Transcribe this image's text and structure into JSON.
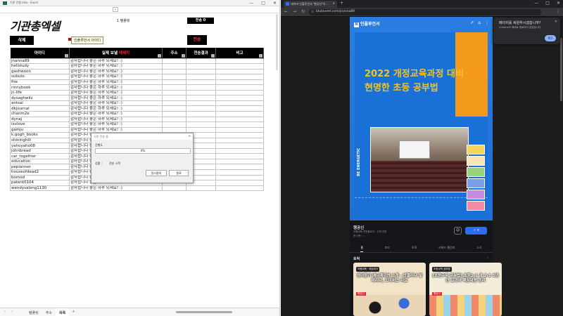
{
  "excel": {
    "title": "기관 인형.xlsx - Excel",
    "window_buttons": [
      "—",
      "□",
      "✕"
    ],
    "expand_glyph": "⌄",
    "logo": "기관총엑셀",
    "template_label": "템플릿",
    "sent_label": "전송 0",
    "delete_button": "삭제",
    "send_button": "전송",
    "comment": "인플루언서 아이디",
    "columns": [
      {
        "label": "아이디",
        "width": 84
      },
      {
        "label": "실제 보낼",
        "label_red": "메세지",
        "width": 132
      },
      {
        "label": "주소",
        "width": 34
      },
      {
        "label": "전송결과",
        "width": 42
      },
      {
        "label": "비고",
        "width": 68
      }
    ],
    "rows": [
      [
        "jnanna89",
        "감사합니다 좋은 하루 되세요! :)"
      ],
      [
        "hellstudy",
        "감사합니다 좋은 하루 되세요! :)"
      ],
      [
        "gashwoon",
        "감사합니다 좋은 하루 되세요! :)"
      ],
      [
        "subuto",
        "감사합니다 좋은 하루 되세요! :)"
      ],
      [
        "fire",
        "감사합니다 좋은 하루 되세요! :)"
      ],
      [
        "rinnybook",
        "감사합니다 좋은 하루 되세요! :)"
      ],
      [
        "jc-life",
        "감사합니다 좋은 하루 되세요! :)"
      ],
      [
        "dysaghwils",
        "감사합니다 좋은 하루 되세요! :)"
      ],
      [
        "antsal",
        "감사합니다 좋은 하루 되세요! :)"
      ],
      [
        "dkjournal",
        "감사합니다 좋은 하루 되세요! :)"
      ],
      [
        "chanm2e",
        "감사합니다 좋은 하루 되세요! :)"
      ],
      [
        "dynaj",
        "감사합니다 좋은 하루 되세요! :)"
      ],
      [
        "ixvlove",
        "감사합니다 좋은 하루 되세요! :)"
      ],
      [
        "gamju",
        "감사합니다 좋은 하루 되세요! :)"
      ],
      [
        "k.gogh_books",
        "감사합니다 좋은 하루 되세요! :)"
      ],
      [
        "shininghill",
        "감사합니다 좋은 하루 되세요! :)"
      ],
      [
        "yahoyaho08",
        "감사합니다 좋은 하루 되세요! :)"
      ],
      [
        "johnbread",
        "감사합니다 좋은 하루 되세요! :)"
      ],
      [
        "car_together",
        "감사합니다 좋은 하루 되세요! :)"
      ],
      [
        "education",
        "감사합니다 좋은 하루 되세요! :)"
      ],
      [
        "peplanner",
        "감사합니다 좋은 하루 되세요! :)"
      ],
      [
        "houseofdead2",
        "감사합니다 좋은 하루 되세요! :)"
      ],
      [
        "bomod",
        "감사합니다 좋은 하루 되세요! :)"
      ],
      [
        "patent0104",
        "감사합니다 좋은 하루 되세요! :)"
      ],
      [
        "wendysalong1130",
        "감사합니다 좋은 하루 되세요! :)"
      ]
    ],
    "dialog": {
      "title": "기관 전송 중",
      "progress_label": "진행도",
      "progress_text": "0%",
      "progress_value": 0,
      "status_label": "상황 :",
      "status_value": "전송 시작",
      "pause_button": "일시중지",
      "close_button": "종료"
    },
    "sheet_nav": [
      "‹",
      "›"
    ],
    "sheets": [
      "템플릿",
      "주소",
      "목록"
    ],
    "active_sheet": 2,
    "add_sheet": "+",
    "accent": "#1e7145"
  },
  "chrome": {
    "tab_title": "네이버 인플루언서 '행공신'의 ...",
    "url": "blutaveet.com/jnanna89",
    "nav": [
      "←",
      "→",
      "↻"
    ],
    "menu_icon": "⋮",
    "popup": {
      "title": "페이지를 복원하시겠습니까?",
      "desc": "Chrome이 제대로 종료되지 않았습니다.",
      "button": "복구"
    }
  },
  "blog": {
    "brand": "인플루언서",
    "brand_icon": "N",
    "header_icons": [
      "↗",
      "⌂",
      "⋮"
    ],
    "headline1": "2022 개정교육과정 대비",
    "headline2": "현명한 초등 공부법",
    "side_text": "BE ENERGETIC",
    "name": "행공신",
    "desc": "여행교육 전문블로거 · 수학 전문",
    "more": "한 이란 › ›",
    "message_icon": "☺",
    "subscribe": "✓ ▾",
    "tabs": [
      "홈",
      "피드",
      "토픽",
      "키워드 챌린지",
      "소식"
    ],
    "active_tab": 0,
    "section_title": "토픽",
    "section_arrow": "›",
    "cards": [
      {
        "badge": "여행교육 · 에듀테크",
        "title": "영어듣기 애니메이션 소개 - 안젤리나 발레리나, 꼬마버스 타요",
        "author": "행공신"
      },
      {
        "badge": "초등수학 공부법",
        "title": "[초등수학 공부법] 초등1-1 과 2-1 3년간 교과서 핵심내용 정리",
        "author": "행공신"
      }
    ],
    "accent": "#2d6df6"
  }
}
